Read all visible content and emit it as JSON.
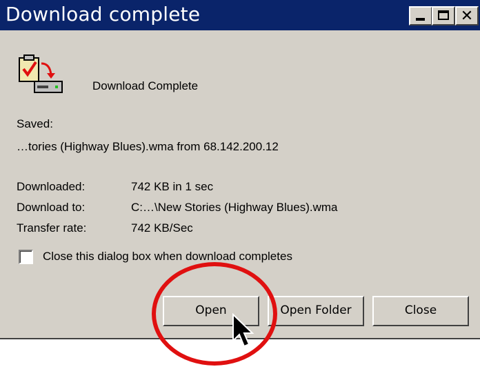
{
  "window": {
    "title": "Download complete"
  },
  "header": {
    "icon": "download-complete-icon",
    "label": "Download Complete"
  },
  "saved": {
    "label": "Saved:",
    "value": "…tories (Highway Blues).wma from 68.142.200.12"
  },
  "details": [
    {
      "label": "Downloaded:",
      "value": "742 KB in 1 sec"
    },
    {
      "label": "Download to:",
      "value": "C:…\\New Stories (Highway Blues).wma"
    },
    {
      "label": "Transfer rate:",
      "value": "742 KB/Sec"
    }
  ],
  "checkbox": {
    "label": "Close this dialog box when download completes",
    "checked": false
  },
  "buttons": {
    "open": "Open",
    "open_folder": "Open Folder",
    "close": "Close"
  },
  "colors": {
    "titlebar": "#0a246a",
    "dialog_bg": "#d4d0c8",
    "highlight": "#e01010"
  }
}
